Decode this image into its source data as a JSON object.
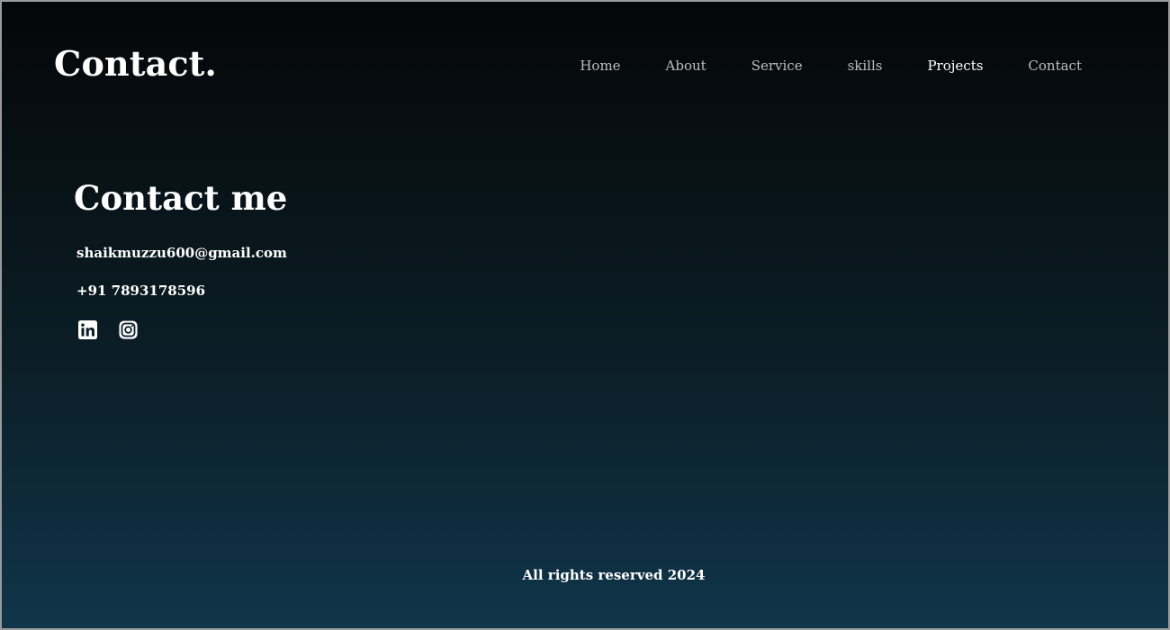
{
  "header": {
    "logo": "Contact.",
    "nav": [
      {
        "label": "Home",
        "active": false
      },
      {
        "label": "About",
        "active": false
      },
      {
        "label": "Service",
        "active": false
      },
      {
        "label": "skills",
        "active": false
      },
      {
        "label": "Projects",
        "active": true
      },
      {
        "label": "Contact",
        "active": false
      }
    ]
  },
  "contact": {
    "heading": "Contact me",
    "email": "shaikmuzzu600@gmail.com",
    "phone": "+91 7893178596",
    "socials": [
      {
        "icon": "linkedin-icon"
      },
      {
        "icon": "instagram-icon"
      }
    ]
  },
  "footer": {
    "text": "All rights reserved 2024"
  },
  "colors": {
    "background_top": "#050608",
    "background_bottom": "#10354a",
    "text": "#ffffff",
    "nav_text": "#bdbdbd"
  }
}
